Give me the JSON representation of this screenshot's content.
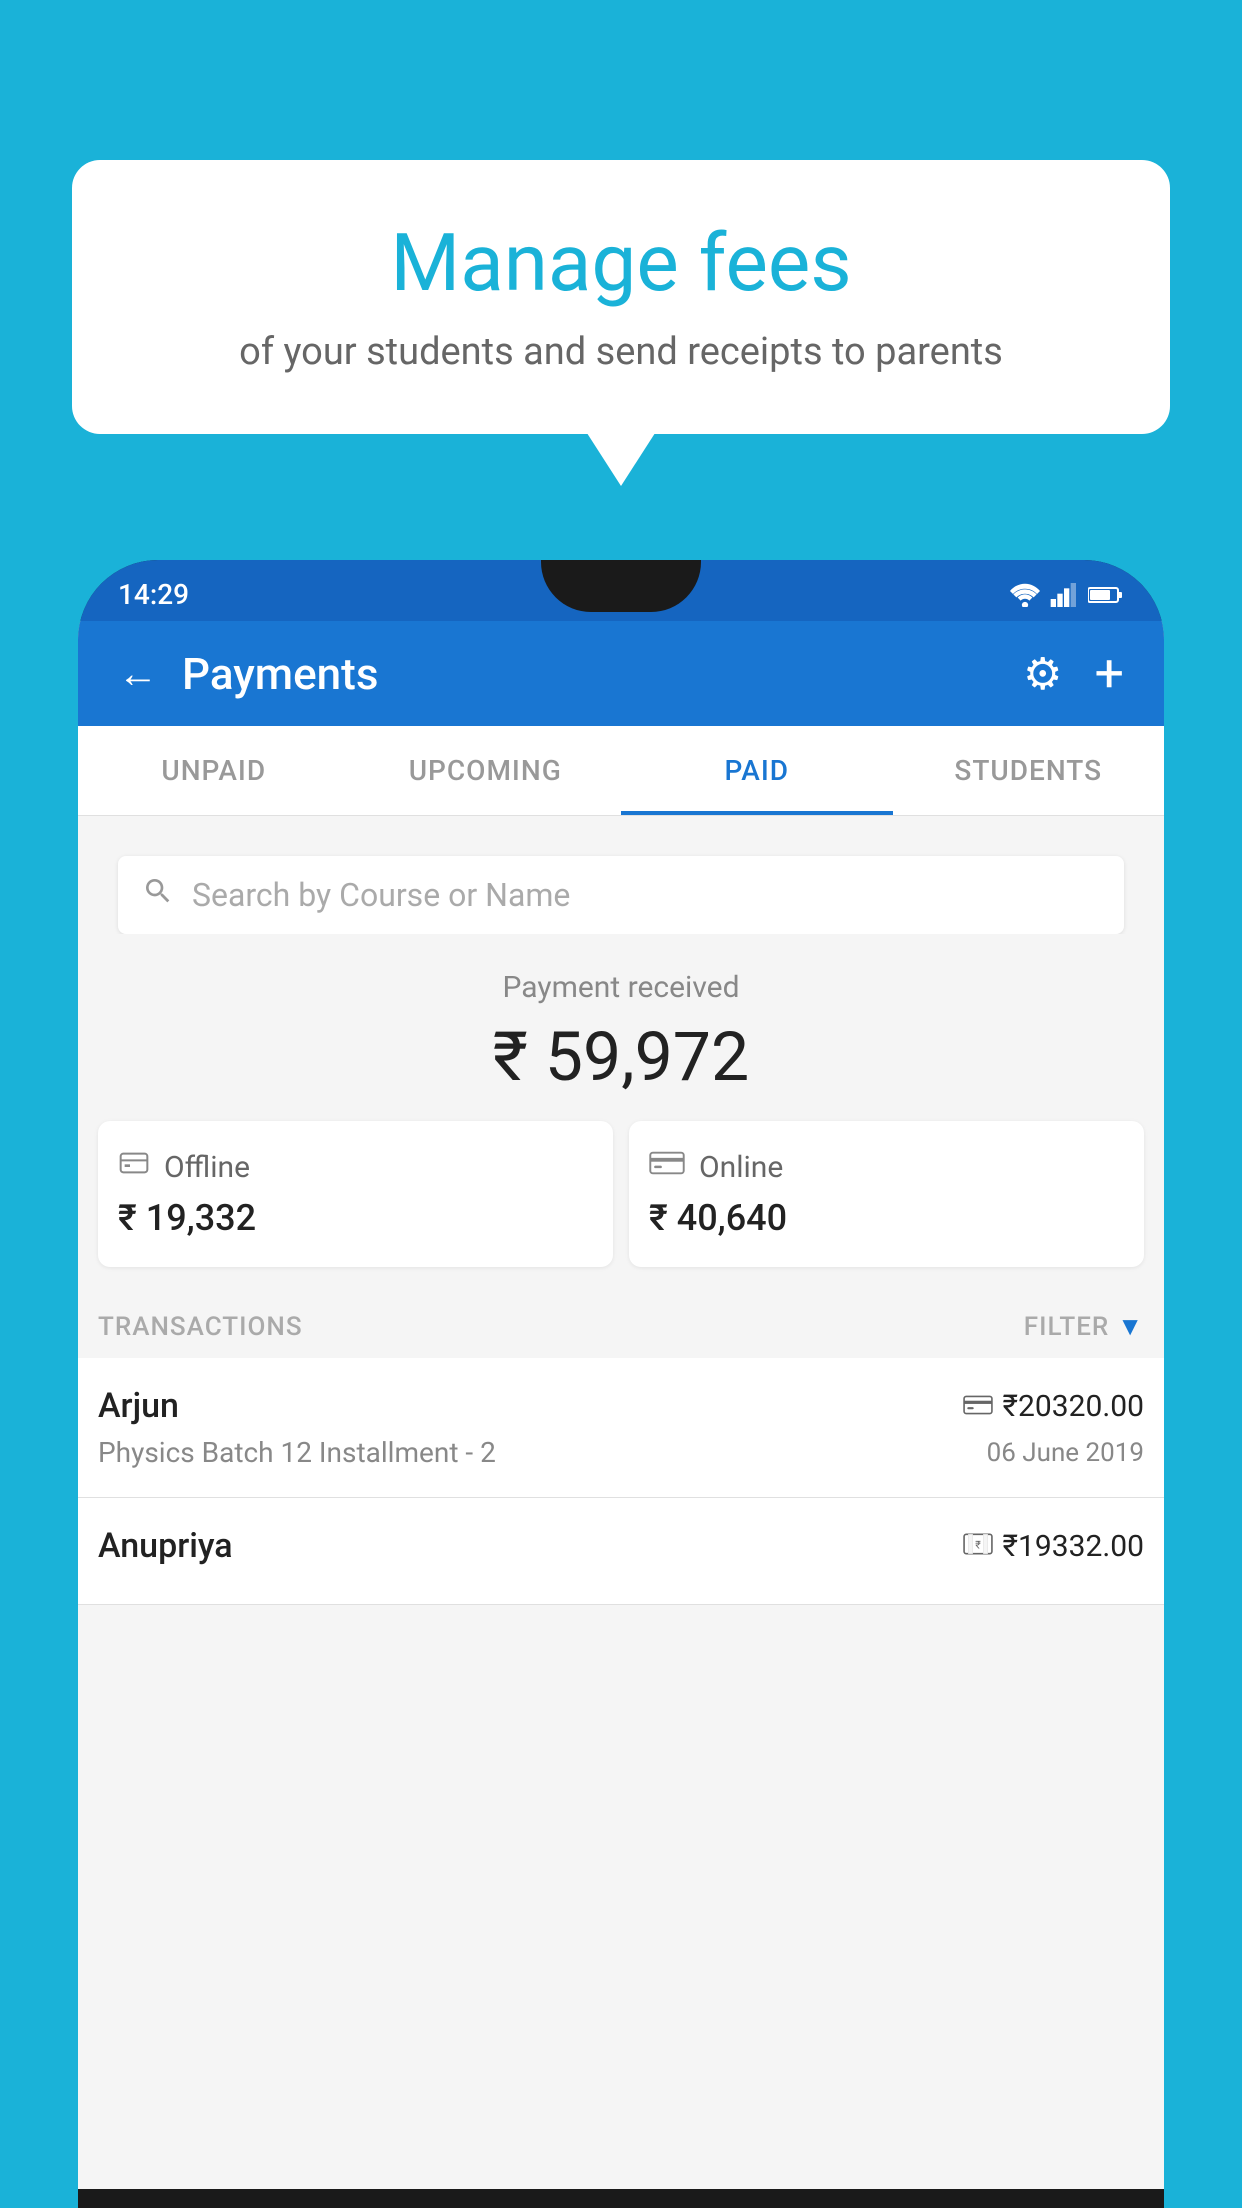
{
  "background_color": "#1ab2d8",
  "speech_bubble": {
    "title": "Manage fees",
    "subtitle": "of your students and send receipts to parents"
  },
  "phone": {
    "status_bar": {
      "time": "14:29"
    },
    "header": {
      "title": "Payments",
      "back_label": "←",
      "settings_label": "⚙",
      "add_label": "+"
    },
    "tabs": [
      {
        "label": "UNPAID",
        "active": false
      },
      {
        "label": "UPCOMING",
        "active": false
      },
      {
        "label": "PAID",
        "active": true
      },
      {
        "label": "STUDENTS",
        "active": false
      }
    ],
    "search": {
      "placeholder": "Search by Course or Name"
    },
    "payment_summary": {
      "received_label": "Payment received",
      "total_amount": "₹ 59,972",
      "offline": {
        "label": "Offline",
        "amount": "₹ 19,332"
      },
      "online": {
        "label": "Online",
        "amount": "₹ 40,640"
      }
    },
    "transactions_section": {
      "label": "TRANSACTIONS",
      "filter_label": "FILTER"
    },
    "transactions": [
      {
        "name": "Arjun",
        "payment_type": "card",
        "amount": "₹20320.00",
        "course": "Physics Batch 12 Installment - 2",
        "date": "06 June 2019"
      },
      {
        "name": "Anupriya",
        "payment_type": "cash",
        "amount": "₹19332.00",
        "course": "",
        "date": ""
      }
    ]
  }
}
